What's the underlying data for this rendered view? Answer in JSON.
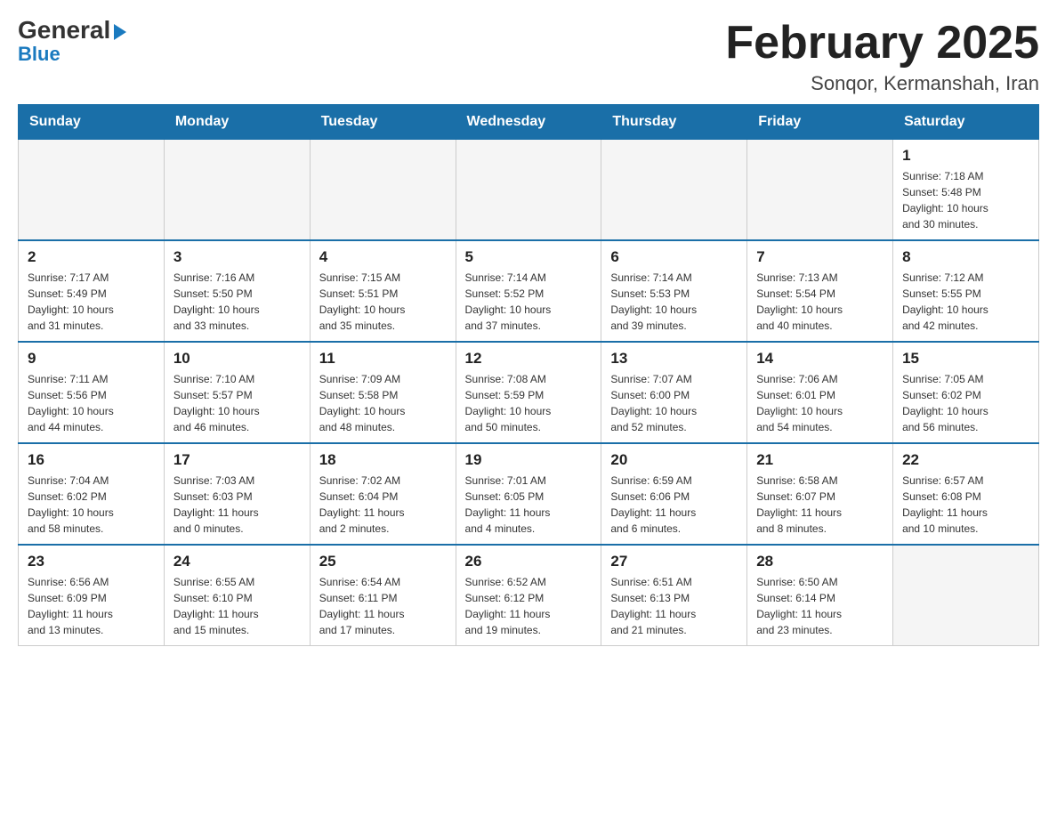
{
  "header": {
    "logo_general": "General",
    "logo_blue": "Blue",
    "month_title": "February 2025",
    "location": "Sonqor, Kermanshah, Iran"
  },
  "days_of_week": [
    "Sunday",
    "Monday",
    "Tuesday",
    "Wednesday",
    "Thursday",
    "Friday",
    "Saturday"
  ],
  "weeks": [
    {
      "days": [
        {
          "number": "",
          "info": ""
        },
        {
          "number": "",
          "info": ""
        },
        {
          "number": "",
          "info": ""
        },
        {
          "number": "",
          "info": ""
        },
        {
          "number": "",
          "info": ""
        },
        {
          "number": "",
          "info": ""
        },
        {
          "number": "1",
          "info": "Sunrise: 7:18 AM\nSunset: 5:48 PM\nDaylight: 10 hours\nand 30 minutes."
        }
      ]
    },
    {
      "days": [
        {
          "number": "2",
          "info": "Sunrise: 7:17 AM\nSunset: 5:49 PM\nDaylight: 10 hours\nand 31 minutes."
        },
        {
          "number": "3",
          "info": "Sunrise: 7:16 AM\nSunset: 5:50 PM\nDaylight: 10 hours\nand 33 minutes."
        },
        {
          "number": "4",
          "info": "Sunrise: 7:15 AM\nSunset: 5:51 PM\nDaylight: 10 hours\nand 35 minutes."
        },
        {
          "number": "5",
          "info": "Sunrise: 7:14 AM\nSunset: 5:52 PM\nDaylight: 10 hours\nand 37 minutes."
        },
        {
          "number": "6",
          "info": "Sunrise: 7:14 AM\nSunset: 5:53 PM\nDaylight: 10 hours\nand 39 minutes."
        },
        {
          "number": "7",
          "info": "Sunrise: 7:13 AM\nSunset: 5:54 PM\nDaylight: 10 hours\nand 40 minutes."
        },
        {
          "number": "8",
          "info": "Sunrise: 7:12 AM\nSunset: 5:55 PM\nDaylight: 10 hours\nand 42 minutes."
        }
      ]
    },
    {
      "days": [
        {
          "number": "9",
          "info": "Sunrise: 7:11 AM\nSunset: 5:56 PM\nDaylight: 10 hours\nand 44 minutes."
        },
        {
          "number": "10",
          "info": "Sunrise: 7:10 AM\nSunset: 5:57 PM\nDaylight: 10 hours\nand 46 minutes."
        },
        {
          "number": "11",
          "info": "Sunrise: 7:09 AM\nSunset: 5:58 PM\nDaylight: 10 hours\nand 48 minutes."
        },
        {
          "number": "12",
          "info": "Sunrise: 7:08 AM\nSunset: 5:59 PM\nDaylight: 10 hours\nand 50 minutes."
        },
        {
          "number": "13",
          "info": "Sunrise: 7:07 AM\nSunset: 6:00 PM\nDaylight: 10 hours\nand 52 minutes."
        },
        {
          "number": "14",
          "info": "Sunrise: 7:06 AM\nSunset: 6:01 PM\nDaylight: 10 hours\nand 54 minutes."
        },
        {
          "number": "15",
          "info": "Sunrise: 7:05 AM\nSunset: 6:02 PM\nDaylight: 10 hours\nand 56 minutes."
        }
      ]
    },
    {
      "days": [
        {
          "number": "16",
          "info": "Sunrise: 7:04 AM\nSunset: 6:02 PM\nDaylight: 10 hours\nand 58 minutes."
        },
        {
          "number": "17",
          "info": "Sunrise: 7:03 AM\nSunset: 6:03 PM\nDaylight: 11 hours\nand 0 minutes."
        },
        {
          "number": "18",
          "info": "Sunrise: 7:02 AM\nSunset: 6:04 PM\nDaylight: 11 hours\nand 2 minutes."
        },
        {
          "number": "19",
          "info": "Sunrise: 7:01 AM\nSunset: 6:05 PM\nDaylight: 11 hours\nand 4 minutes."
        },
        {
          "number": "20",
          "info": "Sunrise: 6:59 AM\nSunset: 6:06 PM\nDaylight: 11 hours\nand 6 minutes."
        },
        {
          "number": "21",
          "info": "Sunrise: 6:58 AM\nSunset: 6:07 PM\nDaylight: 11 hours\nand 8 minutes."
        },
        {
          "number": "22",
          "info": "Sunrise: 6:57 AM\nSunset: 6:08 PM\nDaylight: 11 hours\nand 10 minutes."
        }
      ]
    },
    {
      "days": [
        {
          "number": "23",
          "info": "Sunrise: 6:56 AM\nSunset: 6:09 PM\nDaylight: 11 hours\nand 13 minutes."
        },
        {
          "number": "24",
          "info": "Sunrise: 6:55 AM\nSunset: 6:10 PM\nDaylight: 11 hours\nand 15 minutes."
        },
        {
          "number": "25",
          "info": "Sunrise: 6:54 AM\nSunset: 6:11 PM\nDaylight: 11 hours\nand 17 minutes."
        },
        {
          "number": "26",
          "info": "Sunrise: 6:52 AM\nSunset: 6:12 PM\nDaylight: 11 hours\nand 19 minutes."
        },
        {
          "number": "27",
          "info": "Sunrise: 6:51 AM\nSunset: 6:13 PM\nDaylight: 11 hours\nand 21 minutes."
        },
        {
          "number": "28",
          "info": "Sunrise: 6:50 AM\nSunset: 6:14 PM\nDaylight: 11 hours\nand 23 minutes."
        },
        {
          "number": "",
          "info": ""
        }
      ]
    }
  ]
}
